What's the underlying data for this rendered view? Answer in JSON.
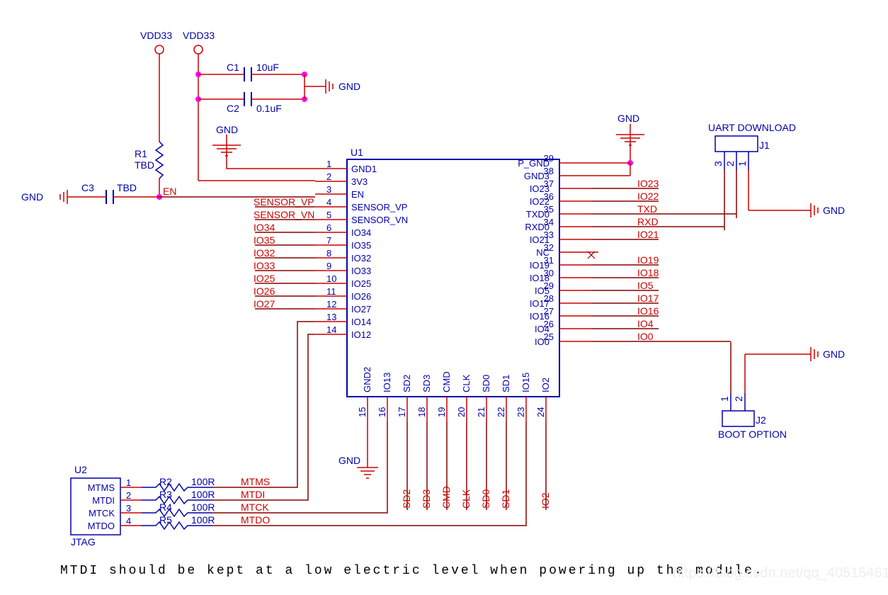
{
  "power": {
    "vdd33_1": "VDD33",
    "vdd33_2": "VDD33",
    "r1": "R1",
    "r1_val": "TBD",
    "c3": "C3",
    "c3_val": "TBD",
    "en": "EN",
    "gnd_left": "GND",
    "c1": "C1",
    "c1_val": "10uF",
    "c2": "C2",
    "c2_val": "0.1uF",
    "gnd_caps": "GND",
    "gnd_top": "GND"
  },
  "u1": {
    "ref": "U1",
    "left_pins": [
      {
        "num": "1",
        "name": "GND1",
        "net": ""
      },
      {
        "num": "2",
        "name": "3V3",
        "net": ""
      },
      {
        "num": "3",
        "name": "EN",
        "net": ""
      },
      {
        "num": "4",
        "name": "SENSOR_VP",
        "net": "SENSOR_VP"
      },
      {
        "num": "5",
        "name": "SENSOR_VN",
        "net": "SENSOR_VN"
      },
      {
        "num": "6",
        "name": "IO34",
        "net": "IO34"
      },
      {
        "num": "7",
        "name": "IO35",
        "net": "IO35"
      },
      {
        "num": "8",
        "name": "IO32",
        "net": "IO32"
      },
      {
        "num": "9",
        "name": "IO33",
        "net": "IO33"
      },
      {
        "num": "10",
        "name": "IO25",
        "net": "IO25"
      },
      {
        "num": "11",
        "name": "IO26",
        "net": "IO26"
      },
      {
        "num": "12",
        "name": "IO27",
        "net": "IO27"
      },
      {
        "num": "13",
        "name": "IO14",
        "net": ""
      },
      {
        "num": "14",
        "name": "IO12",
        "net": ""
      }
    ],
    "right_pins": [
      {
        "num": "39",
        "name": "P_GND",
        "net": ""
      },
      {
        "num": "38",
        "name": "GND3",
        "net": ""
      },
      {
        "num": "37",
        "name": "IO23",
        "net": "IO23"
      },
      {
        "num": "36",
        "name": "IO22",
        "net": "IO22"
      },
      {
        "num": "35",
        "name": "TXD0",
        "net": "TXD"
      },
      {
        "num": "34",
        "name": "RXD0",
        "net": "RXD"
      },
      {
        "num": "33",
        "name": "IO21",
        "net": "IO21"
      },
      {
        "num": "32",
        "name": "NC",
        "net": ""
      },
      {
        "num": "31",
        "name": "IO19",
        "net": "IO19"
      },
      {
        "num": "30",
        "name": "IO18",
        "net": "IO18"
      },
      {
        "num": "29",
        "name": "IO5",
        "net": "IO5"
      },
      {
        "num": "28",
        "name": "IO17",
        "net": "IO17"
      },
      {
        "num": "27",
        "name": "IO16",
        "net": "IO16"
      },
      {
        "num": "26",
        "name": "IO4",
        "net": "IO4"
      },
      {
        "num": "25",
        "name": "IO0",
        "net": "IO0"
      }
    ],
    "bottom_pins": [
      {
        "num": "15",
        "name": "GND2",
        "net": ""
      },
      {
        "num": "16",
        "name": "IO13",
        "net": ""
      },
      {
        "num": "17",
        "name": "SD2",
        "net": "SD2"
      },
      {
        "num": "18",
        "name": "SD3",
        "net": "SD3"
      },
      {
        "num": "19",
        "name": "CMD",
        "net": "CMD"
      },
      {
        "num": "20",
        "name": "CLK",
        "net": "CLK"
      },
      {
        "num": "21",
        "name": "SD0",
        "net": "SD0"
      },
      {
        "num": "22",
        "name": "SD1",
        "net": "SD1"
      },
      {
        "num": "23",
        "name": "IO15",
        "net": ""
      },
      {
        "num": "24",
        "name": "IO2",
        "net": "IO2"
      }
    ],
    "gnd_bottom": "GND"
  },
  "u2": {
    "ref": "U2",
    "label": "JTAG",
    "pins": [
      {
        "num": "1",
        "name": "MTMS",
        "r": "R2",
        "rval": "100R",
        "net": "MTMS"
      },
      {
        "num": "2",
        "name": "MTDI",
        "r": "R3",
        "rval": "100R",
        "net": "MTDI"
      },
      {
        "num": "3",
        "name": "MTCK",
        "r": "R4",
        "rval": "100R",
        "net": "MTCK"
      },
      {
        "num": "4",
        "name": "MTDO",
        "r": "R5",
        "rval": "100R",
        "net": "MTDO"
      }
    ]
  },
  "j1": {
    "ref": "J1",
    "label": "UART DOWNLOAD",
    "pins": [
      "3",
      "2",
      "1"
    ],
    "gnd": "GND"
  },
  "j2": {
    "ref": "J2",
    "label": "BOOT OPTION",
    "pins": [
      "1",
      "2"
    ],
    "gnd": "GND"
  },
  "top_right_gnd": "GND",
  "note": "MTDI should be kept at a low electric level when powering up the module.",
  "watermark": "https://blog.csdn.net/qq_40515461"
}
